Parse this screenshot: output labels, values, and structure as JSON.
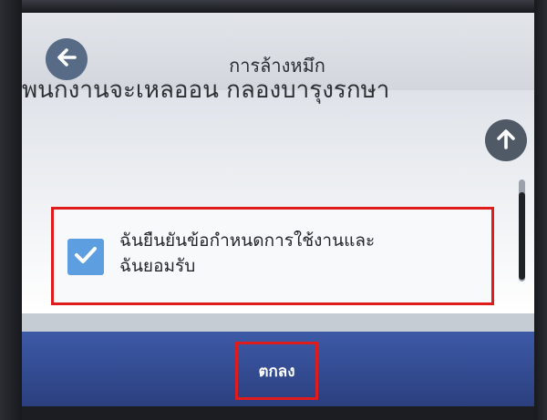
{
  "header": {
    "title": "การล้างหมึก",
    "back_icon": "arrow-left-icon"
  },
  "content": {
    "scrolled_text": "พนกงานจะเหลออน กลองบารุงรกษา",
    "scroll_up_icon": "arrow-up-icon",
    "agree_checkbox": {
      "checked": true,
      "label_line1": "ฉันยืนยันข้อกำหนดการใช้งานและ",
      "label_line2": "ฉันยอมรับ"
    }
  },
  "footer": {
    "ok_label": "ตกลง"
  },
  "colors": {
    "accent_blue": "#3d5aa7",
    "checkbox_blue": "#5d9ee0",
    "highlight_red": "#e01b1b"
  }
}
